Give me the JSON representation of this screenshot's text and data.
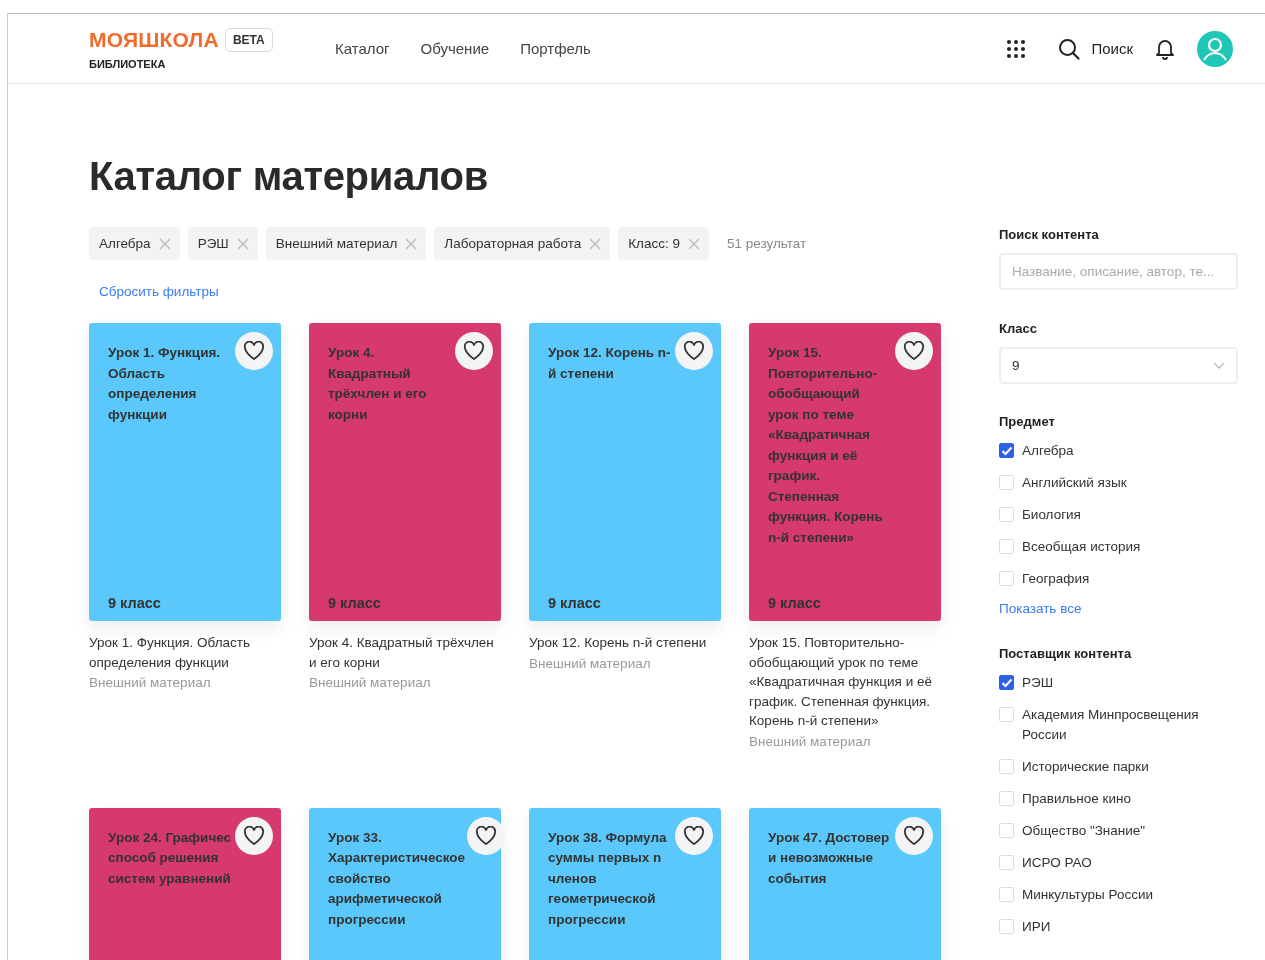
{
  "header": {
    "logo": "МОЯШКОЛА",
    "badge": "BETA",
    "sublabel": "БИБЛИОТЕКА",
    "nav": [
      {
        "label": "Каталог"
      },
      {
        "label": "Обучение"
      },
      {
        "label": "Портфель"
      }
    ],
    "search_label": "Поиск"
  },
  "page_title": "Каталог материалов",
  "filters": [
    {
      "label": "Алгебра"
    },
    {
      "label": "РЭШ"
    },
    {
      "label": "Внешний материал"
    },
    {
      "label": "Лабораторная работа"
    },
    {
      "label": "Класс: 9"
    }
  ],
  "result_count": "51 результат",
  "reset_label": "Сбросить фильтры",
  "cards": [
    {
      "title": "Урок 1. Функция. Область определения функции",
      "grade": "9 класс",
      "color": "#5ac8fa",
      "caption": "Урок 1. Функция. Область определения функции",
      "source": "Внешний материал"
    },
    {
      "title": "Урок 4. Квадратный трёхчлен и его корни",
      "grade": "9 класс",
      "color": "#d6396d",
      "caption": "Урок 4. Квадратный трёхчлен и его корни",
      "source": "Внешний материал"
    },
    {
      "title": "Урок 12. Корень n-й степени",
      "grade": "9 класс",
      "color": "#5ac8fa",
      "caption": "Урок 12. Корень n-й степени",
      "source": "Внешний материал"
    },
    {
      "title": "Урок 15. Повторительно-обобщающий урок по теме «Квадратичная функция и её график. Степенная функция. Корень n-й степени»",
      "grade": "9 класс",
      "color": "#d6396d",
      "caption": "Урок 15. Повторительно-обобщающий урок по теме «Квадратичная функция и её график. Степенная функция. Корень n-й степени»",
      "source": "Внешний материал"
    },
    {
      "title": "Урок 24. Графичес способ решения систем уравнений",
      "color": "#d6396d"
    },
    {
      "title": "Урок 33. Характеристическое свойство арифметической прогрессии",
      "color": "#5ac8fa"
    },
    {
      "title": "Урок 38. Формула суммы первых n членов геометрической прогрессии",
      "color": "#5ac8fa"
    },
    {
      "title": "Урок 47. Достовер и невозможные события",
      "color": "#5ac8fa"
    }
  ],
  "sidebar": {
    "search": {
      "heading": "Поиск контента",
      "placeholder": "Название, описание, автор, те..."
    },
    "grade": {
      "heading": "Класс",
      "value": "9"
    },
    "subject": {
      "heading": "Предмет",
      "options": [
        {
          "label": "Алгебра",
          "checked": true
        },
        {
          "label": "Английский язык",
          "checked": false
        },
        {
          "label": "Биология",
          "checked": false
        },
        {
          "label": "Всеобщая история",
          "checked": false
        },
        {
          "label": "География",
          "checked": false
        }
      ],
      "show_all": "Показать все"
    },
    "provider": {
      "heading": "Поставщик контента",
      "options": [
        {
          "label": "РЭШ",
          "checked": true
        },
        {
          "label": "Академия Минпросвещения России",
          "checked": false
        },
        {
          "label": "Исторические парки",
          "checked": false
        },
        {
          "label": "Правильное кино",
          "checked": false
        },
        {
          "label": "Общество \"Знание\"",
          "checked": false
        },
        {
          "label": "ИСРО РАО",
          "checked": false
        },
        {
          "label": "Минкультуры России",
          "checked": false
        },
        {
          "label": "ИРИ",
          "checked": false
        }
      ]
    }
  }
}
